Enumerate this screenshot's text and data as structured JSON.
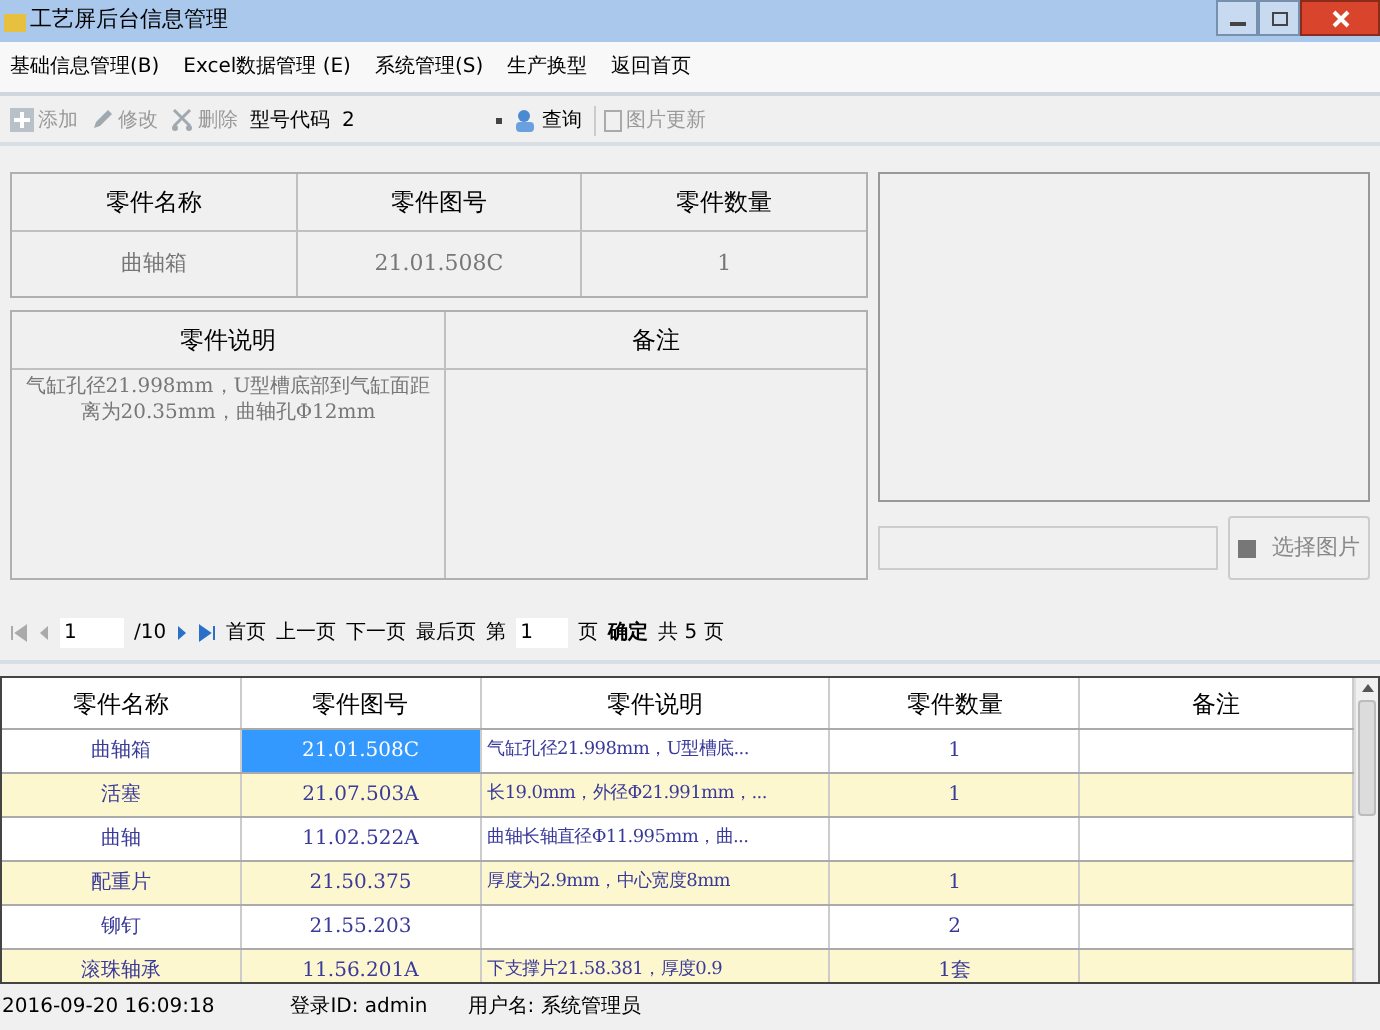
{
  "window": {
    "title": "工艺屏后台信息管理"
  },
  "menu": [
    "基础信息管理(B)",
    "Excel数据管理 (E)",
    "系统管理(S)",
    "生产换型",
    "返回首页"
  ],
  "toolbar": {
    "buttons": [
      {
        "label": "添加",
        "kind": "add",
        "disabled": true
      },
      {
        "label": "修改",
        "kind": "edit",
        "disabled": true
      },
      {
        "label": "删除",
        "kind": "delete",
        "disabled": true
      }
    ],
    "model_label": "型号代码",
    "model_value": "2",
    "query": "查询",
    "image_update": {
      "label": "图片更新",
      "disabled": true
    }
  },
  "detail": {
    "columns": [
      "零件名称",
      "零件图号",
      "零件数量"
    ],
    "values": [
      "曲轴箱",
      "21.01.508C",
      "1"
    ],
    "desc_header": "零件说明",
    "remark_header": "备注",
    "desc": "气缸孔径21.998mm，U型槽底部到气缸面距离为20.35mm，曲轴孔Φ12mm",
    "choose_image": "选择图片"
  },
  "pager": {
    "current": "1",
    "total": "/10",
    "first": "首页",
    "prev": "上一页",
    "next": "下一页",
    "last": "最后页",
    "page_prefix": "第",
    "page_value": "1",
    "page_suffix": "页",
    "confirm": "确定",
    "count": "共 5 页"
  },
  "table": {
    "columns": [
      "零件名称",
      "零件图号",
      "零件说明",
      "零件数量",
      "备注"
    ],
    "rows": [
      {
        "cells": [
          "曲轴箱",
          "21.01.508C",
          "气缸孔径21.998mm，U型槽底...",
          "1",
          ""
        ],
        "selected": true
      },
      {
        "cells": [
          "活塞",
          "21.07.503A",
          "长19.0mm，外径Φ21.991mm，...",
          "1",
          ""
        ],
        "selected": false
      },
      {
        "cells": [
          "曲轴",
          "11.02.522A",
          "曲轴长轴直径Φ11.995mm，曲...",
          "",
          ""
        ],
        "selected": false
      },
      {
        "cells": [
          "配重片",
          "21.50.375",
          "厚度为2.9mm，中心宽度8mm",
          "1",
          ""
        ],
        "selected": false
      },
      {
        "cells": [
          "铆钉",
          "21.55.203",
          "",
          "2",
          ""
        ],
        "selected": false
      },
      {
        "cells": [
          "滚珠轴承",
          "11.56.201A",
          "下支撑片21.58.381，厚度0.9",
          "1套",
          ""
        ],
        "selected": false
      }
    ]
  },
  "status_bar": {
    "time": "2016-09-20 16:09:18",
    "login": "登录ID: admin",
    "user": "用户名: 系统管理员"
  }
}
